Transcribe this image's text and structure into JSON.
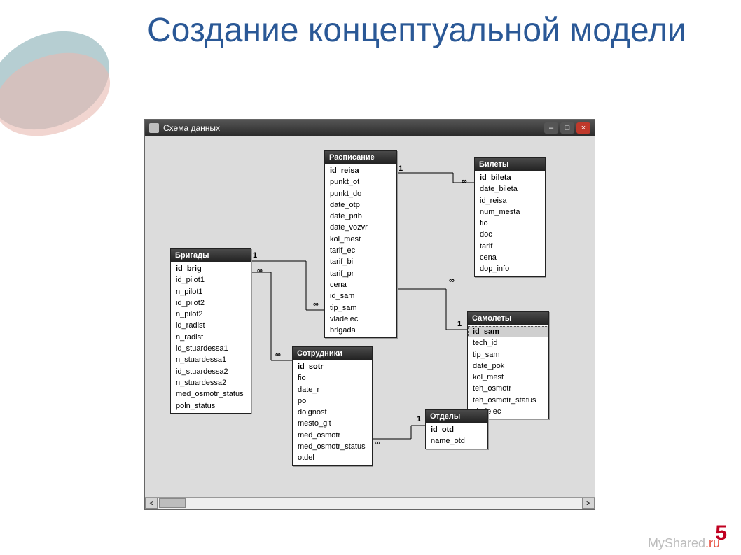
{
  "slide": {
    "title": "Создание концептуальной модели",
    "page_number": "5",
    "footer_brand_1": "My",
    "footer_brand_2": "Shared",
    "footer_brand_3": ".ru"
  },
  "window": {
    "title": "Схема данных",
    "min": "–",
    "max": "□",
    "close": "×",
    "scroll_left": "<",
    "scroll_right": ">"
  },
  "entities": {
    "brigady": {
      "title": "Бригады",
      "fields": [
        "id_brig",
        "id_pilot1",
        "n_pilot1",
        "id_pilot2",
        "n_pilot2",
        "id_radist",
        "n_radist",
        "id_stuardessa1",
        "n_stuardessa1",
        "id_stuardessa2",
        "n_stuardessa2",
        "med_osmotr_status",
        "poln_status"
      ]
    },
    "raspisanie": {
      "title": "Расписание",
      "fields": [
        "id_reisa",
        "punkt_ot",
        "punkt_do",
        "date_otp",
        "date_prib",
        "date_vozvr",
        "kol_mest",
        "tarif_ec",
        "tarif_bi",
        "tarif_pr",
        "cena",
        "id_sam",
        "tip_sam",
        "vladelec",
        "brigada"
      ]
    },
    "bilety": {
      "title": "Билеты",
      "fields": [
        "id_bileta",
        "date_bileta",
        "id_reisa",
        "num_mesta",
        "fio",
        "doc",
        "tarif",
        "cena",
        "dop_info"
      ]
    },
    "sotrudniki": {
      "title": "Сотрудники",
      "fields": [
        "id_sotr",
        "fio",
        "date_r",
        "pol",
        "dolgnost",
        "mesto_git",
        "med_osmotr",
        "med_osmotr_status",
        "otdel"
      ]
    },
    "samolety": {
      "title": "Самолеты",
      "fields": [
        "id_sam",
        "tech_id",
        "tip_sam",
        "date_pok",
        "kol_mest",
        "teh_osmotr",
        "teh_osmotr_status",
        "vladelec"
      ]
    },
    "otdely": {
      "title": "Отделы",
      "fields": [
        "id_otd",
        "name_otd"
      ]
    }
  },
  "cardinality": {
    "one": "1",
    "many": "∞"
  }
}
